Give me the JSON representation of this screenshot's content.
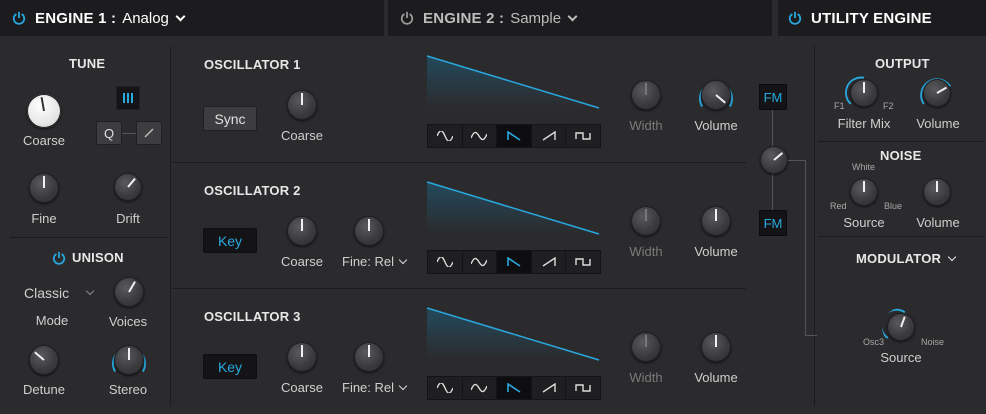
{
  "header": {
    "engine1": {
      "title": "ENGINE 1 :",
      "value": "Analog"
    },
    "engine2": {
      "title": "ENGINE 2 :",
      "value": "Sample"
    },
    "utility": {
      "title": "UTILITY ENGINE"
    }
  },
  "tune": {
    "title": "TUNE",
    "coarse": "Coarse",
    "fine": "Fine",
    "drift": "Drift",
    "quantize": "Q"
  },
  "unison": {
    "title": "UNISON",
    "mode_value": "Classic",
    "mode": "Mode",
    "voices": "Voices",
    "detune": "Detune",
    "stereo": "Stereo"
  },
  "osc1": {
    "title": "OSCILLATOR 1",
    "button": "Sync",
    "coarse": "Coarse",
    "width": "Width",
    "volume": "Volume"
  },
  "osc2": {
    "title": "OSCILLATOR 2",
    "button": "Key",
    "coarse": "Coarse",
    "fine": "Fine: Rel",
    "width": "Width",
    "volume": "Volume"
  },
  "osc3": {
    "title": "OSCILLATOR 3",
    "button": "Key",
    "coarse": "Coarse",
    "fine": "Fine: Rel",
    "width": "Width",
    "volume": "Volume"
  },
  "fm": {
    "top": "FM",
    "bottom": "FM"
  },
  "output": {
    "title": "OUTPUT",
    "f1": "F1",
    "f2": "F2",
    "filter_mix": "Filter Mix",
    "volume": "Volume"
  },
  "noise": {
    "title": "NOISE",
    "white": "White",
    "red": "Red",
    "blue": "Blue",
    "source": "Source",
    "volume": "Volume"
  },
  "modulator": {
    "title": "MODULATOR",
    "osc3": "Osc3",
    "noise": "Noise",
    "source": "Source"
  },
  "colors": {
    "accent": "#28a9e0",
    "background": "#2b2b2d",
    "header": "#1c1c1e"
  }
}
